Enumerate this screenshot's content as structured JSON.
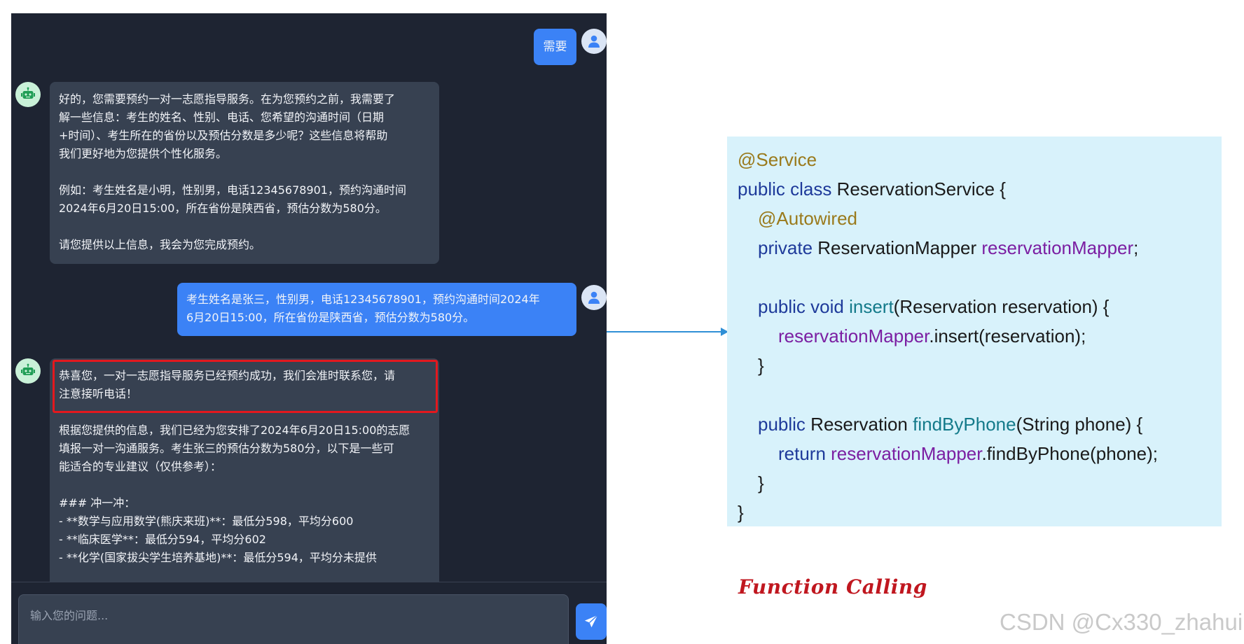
{
  "chat": {
    "messages": [
      {
        "role": "user",
        "text": "需要"
      },
      {
        "role": "bot",
        "text": "好的，您需要预约一对一志愿指导服务。在为您预约之前，我需要了\n解一些信息：考生的姓名、性别、电话、您希望的沟通时间（日期\n+时间）、考生所在的省份以及预估分数是多少呢？这些信息将帮助\n我们更好地为您提供个性化服务。\n\n例如：考生姓名是小明，性别男，电话12345678901，预约沟通时间\n2024年6月20日15:00，所在省份是陕西省，预估分数为580分。\n\n请您提供以上信息，我会为您完成预约。"
      },
      {
        "role": "user",
        "text": "考生姓名是张三，性别男，电话12345678901，预约沟通时间2024年\n6月20日15:00，所在省份是陕西省，预估分数为580分。"
      },
      {
        "role": "bot",
        "highlight": "恭喜您，一对一志愿指导服务已经预约成功，我们会准时联系您，请\n注意接听电话！",
        "text": "根据您提供的信息，我们已经为您安排了2024年6月20日15:00的志愿\n填报一对一沟通服务。考生张三的预估分数为580分，以下是一些可\n能适合的专业建议（仅供参考）：\n\n### 冲一冲：\n- **数学与应用数学(熊庆来班)**：最低分598，平均分600\n- **临床医学**：最低分594，平均分602\n- **化学(国家拔尖学生培养基地)**：最低分594，平均分未提供"
      }
    ],
    "input_placeholder": "输入您的问题..."
  },
  "code": {
    "l1": "@Service",
    "l2a": "public class",
    "l2b": " ReservationService {",
    "l3": "@Autowired",
    "l4a": "private",
    "l4b": " ReservationMapper ",
    "l4c": "reservationMapper",
    "l4d": ";",
    "l5a": "public void",
    "l5b": " insert",
    "l5c": "(Reservation reservation) {",
    "l6a": "reservationMapper",
    "l6b": ".insert(reservation);",
    "l7": "}",
    "l8a": "public",
    "l8b": " Reservation ",
    "l8c": "findByPhone",
    "l8d": "(String phone) {",
    "l9a": "return",
    "l9b": " reservationMapper",
    "l9c": ".findByPhone(phone);",
    "l10": "}",
    "l11": "}"
  },
  "label": "Function Calling",
  "watermark": "CSDN @Cx330_zhahui"
}
